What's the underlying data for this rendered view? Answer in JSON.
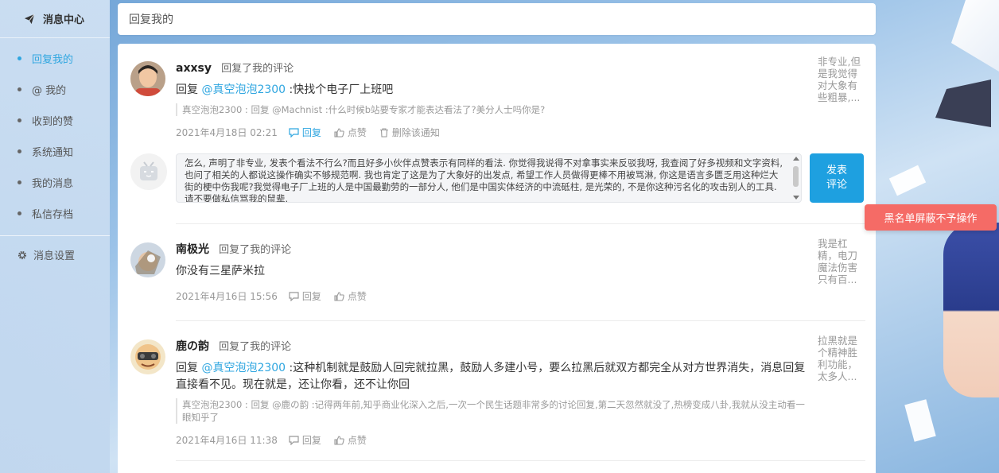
{
  "sidebar": {
    "title": "消息中心",
    "items": [
      {
        "label": "回复我的",
        "active": true
      },
      {
        "label": "@ 我的",
        "active": false
      },
      {
        "label": "收到的赞",
        "active": false
      },
      {
        "label": "系统通知",
        "active": false
      },
      {
        "label": "我的消息",
        "active": false
      },
      {
        "label": "私信存档",
        "active": false
      }
    ],
    "settings": "消息设置"
  },
  "topbar": {
    "title": "回复我的"
  },
  "colors": {
    "accent": "#2fa6e0",
    "send_button": "#1ea0e0",
    "toast": "#f56b66"
  },
  "replies": [
    {
      "user": "axxsy",
      "action": "回复了我的评论",
      "prefix": "回复 ",
      "mention": "@真空泡泡2300",
      "text": " :快找个电子厂上班吧",
      "quote": "真空泡泡2300 : 回复 @Machnist :什么时候b站要专家才能表达看法了?美分人士吗你是?",
      "time": "2021年4月18日 02:21",
      "reply_label": "回复",
      "like_label": "点赞",
      "delete_label": "删除该通知",
      "preview": "非专业,但是我觉得对大象有些粗暴,..."
    },
    {
      "user": "南极光",
      "action": "回复了我的评论",
      "text": "你没有三星萨米拉",
      "time": "2021年4月16日 15:56",
      "reply_label": "回复",
      "like_label": "点赞",
      "preview": "我是杠精，电刀魔法伤害只有百..."
    },
    {
      "user": "鹿の韵",
      "action": "回复了我的评论",
      "prefix": "回复 ",
      "mention": "@真空泡泡2300",
      "text": " :这种机制就是鼓励人回完就拉黑，鼓励人多建小号，要么拉黑后就双方都完全从对方世界消失，消息回复直接看不见。现在就是，还让你看，还不让你回",
      "quote": "真空泡泡2300 : 回复 @鹿の韵 :记得两年前,知乎商业化深入之后,一次一个民生话题非常多的讨论回复,第二天忽然就没了,热榜变成八卦,我就从没主动看一眼知乎了",
      "time": "2021年4月16日 11:38",
      "reply_label": "回复",
      "like_label": "点赞",
      "preview": "拉黑就是个精神胜利功能，太多人..."
    }
  ],
  "reply_box": {
    "text": "怎么, 声明了非专业, 发表个看法不行么?而且好多小伙伴点赞表示有同样的看法. 你觉得我说得不对拿事实来反驳我呀, 我查阅了好多视频和文字资料, 也问了相关的人都说这操作确实不够规范啊. 我也肯定了这是为了大象好的出发点, 希望工作人员做得更棒不用被骂淋, 你这是语言多匮乏用这种烂大街的梗中伤我呢?我觉得电子厂上班的人是中国最勤劳的一部分人, 他们是中国实体经济的中流砥柱, 是光荣的, 不是你这种污名化的攻击别人的工具. 请不要做私信骂我的鼠辈.",
    "send_line1": "发表",
    "send_line2": "评论"
  },
  "toast": {
    "text": "黑名单屏蔽不予操作"
  }
}
